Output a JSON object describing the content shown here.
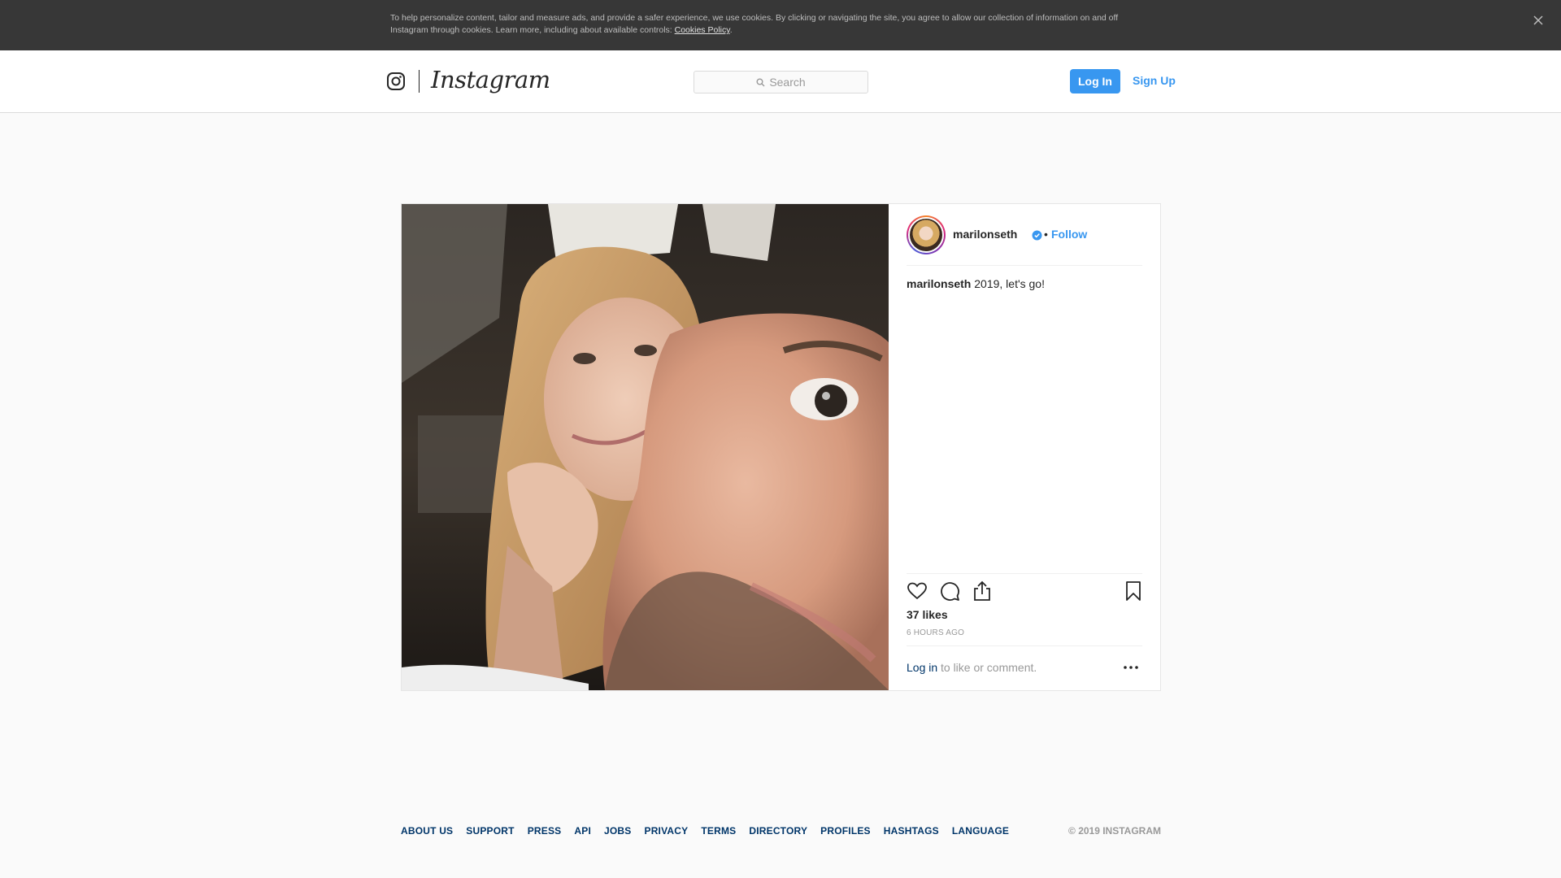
{
  "cookie_banner": {
    "text": "To help personalize content, tailor and measure ads, and provide a safer experience, we use cookies. By clicking or navigating the site, you agree to allow our collection of information on and off Instagram through cookies. Learn more, including about available controls: ",
    "link_label": "Cookies Policy",
    "trailing": "."
  },
  "header": {
    "logo_text": "Instagram",
    "search_placeholder": "Search",
    "login_label": "Log In",
    "signup_label": "Sign Up"
  },
  "post": {
    "username": "marilonseth",
    "dot": "•",
    "follow_label": "Follow",
    "caption_user": "marilonseth",
    "caption_text": " 2019, let's go!",
    "likes": "37 likes",
    "time": "6 HOURS AGO",
    "login_link": "Log in",
    "comment_prompt": " to like or comment."
  },
  "footer": {
    "links": [
      "ABOUT US",
      "SUPPORT",
      "PRESS",
      "API",
      "JOBS",
      "PRIVACY",
      "TERMS",
      "DIRECTORY",
      "PROFILES",
      "HASHTAGS",
      "LANGUAGE"
    ],
    "copyright": "© 2019 INSTAGRAM"
  },
  "colors": {
    "accent": "#3897f0",
    "link_dark": "#003569",
    "muted": "#999999",
    "banner_bg": "#373737"
  },
  "icons": [
    "instagram-glyph-icon",
    "search-icon",
    "verified-badge-icon",
    "heart-icon",
    "comment-icon",
    "share-icon",
    "bookmark-icon",
    "more-icon",
    "close-icon"
  ]
}
